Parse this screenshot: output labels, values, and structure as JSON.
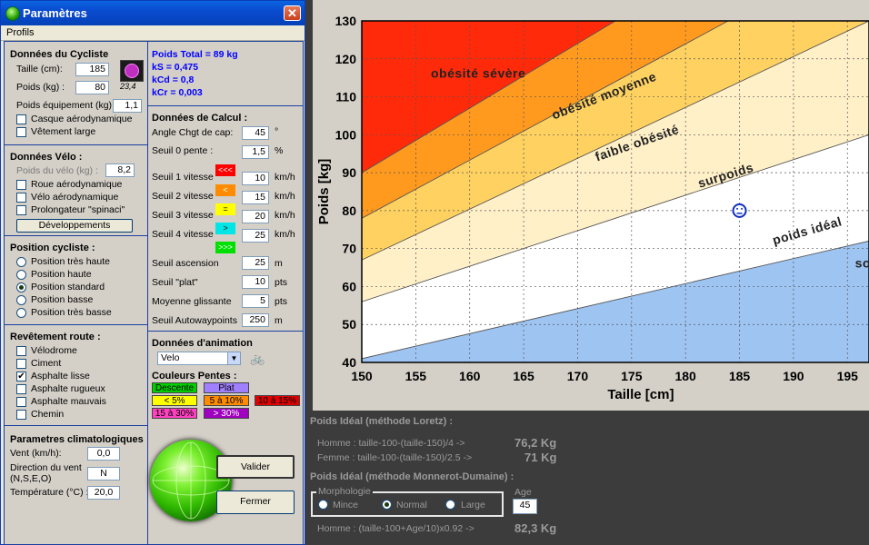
{
  "window": {
    "title": "Paramètres",
    "menu": [
      "Profils"
    ]
  },
  "cycliste": {
    "header": "Données du Cycliste",
    "taille_label": "Taille (cm):",
    "taille": "185",
    "poids_label": "Poids (kg) :",
    "poids": "80",
    "equip_label": "Poids équipement (kg) :",
    "equip": "1,1",
    "casque": "Casque aérodynamique",
    "vetement": "Vêtement large",
    "imc": "23,4"
  },
  "info": {
    "poids_total": "Poids Total = 89 kg",
    "ks": "kS = 0,475",
    "kcd": "kCd = 0,8",
    "kcr": "kCr = 0,003"
  },
  "velo": {
    "header": "Données Vélo :",
    "poids_label": "Poids du vélo (kg) :",
    "poids": "8,2",
    "roue": "Roue aérodynamique",
    "velo_aero": "Vélo aérodynamique",
    "prolong": "Prolongateur \"spinaci\"",
    "dev_button": "Développements"
  },
  "position": {
    "header": "Position cycliste :",
    "items": [
      "Position très haute",
      "Position haute",
      "Position standard",
      "Position basse",
      "Position très basse"
    ]
  },
  "revetement": {
    "header": "Revêtement route :",
    "items": [
      "Vélodrome",
      "Ciment",
      "Asphalte lisse",
      "Asphalte rugueux",
      "Asphalte mauvais",
      "Chemin"
    ]
  },
  "climat": {
    "header": "Parametres climatologiques",
    "vent_label": "Vent (km/h):",
    "vent": "0,0",
    "dir_label1": "Direction du vent",
    "dir_label2": "(N,S,E,O)",
    "dir": "N",
    "temp_label": "Température (°C) :",
    "temp": "20,0"
  },
  "calcul": {
    "header": "Données de Calcul :",
    "angle_label": "Angle Chgt  de cap:",
    "angle": "45",
    "angle_unit": "°",
    "seuil0_label": "Seuil 0 pente :",
    "seuil0": "1,5",
    "seuil0_unit": "%",
    "seuils": [
      {
        "label": "Seuil 1 vitesse",
        "sym": "<<<",
        "value": "10",
        "unit": "km/h",
        "color": "#ff0000"
      },
      {
        "label": "Seuil 2 vitesse",
        "sym": "<",
        "value": "15",
        "unit": "km/h",
        "color": "#ff8c00"
      },
      {
        "label": "Seuil 3 vitesse",
        "sym": "=",
        "value": "20",
        "unit": "km/h",
        "color": "#ffff00"
      },
      {
        "label": "Seuil 4 vitesse",
        "sym": ">",
        "value": "25",
        "unit": "km/h",
        "color": "#00e5e5"
      }
    ],
    "sym5": ">>>",
    "ascension_label": "Seuil  ascension",
    "ascension": "25",
    "ascension_unit": "m",
    "plat_label": "Seuil  \"plat\"",
    "plat": "10",
    "plat_unit": "pts",
    "moyenne_label": "Moyenne glissante",
    "moyenne": "5",
    "moyenne_unit": "pts",
    "autowp_label": "Seuil Autowaypoints",
    "autowp": "250",
    "autowp_unit": "m"
  },
  "animation": {
    "header": "Données d'animation",
    "select": "Velo"
  },
  "couleurs": {
    "header": "Couleurs Pentes :",
    "descente": "Descente",
    "plat": "Plat",
    "c1": "< 5%",
    "c2": "5 à 10%",
    "c3": "10 à 15%",
    "c4": "15 à 30%",
    "c5": "> 30%"
  },
  "buttons": {
    "valider": "Valider",
    "fermer": "Fermer"
  },
  "chart_data": {
    "type": "area",
    "xlabel": "Taille [cm]",
    "ylabel": "Poids [kg]",
    "xlim": [
      150,
      197
    ],
    "ylim": [
      40,
      130
    ],
    "xticks": [
      150,
      155,
      160,
      165,
      170,
      175,
      180,
      185,
      190,
      195
    ],
    "yticks": [
      40,
      50,
      60,
      70,
      80,
      90,
      100,
      110,
      120,
      130
    ],
    "grid": true,
    "bands": [
      {
        "name": "sous",
        "color": "#9ec4f2",
        "lower_at_150": 40,
        "lower_at_197": 40,
        "upper_at_150": 41,
        "upper_at_197": 72
      },
      {
        "name": "poids idéal",
        "color": "#ffffff",
        "lower_at_150": 41,
        "lower_at_197": 72,
        "upper_at_150": 56,
        "upper_at_197": 100
      },
      {
        "name": "surpoids",
        "color": "#fff0c8",
        "lower_at_150": 56,
        "lower_at_197": 100,
        "upper_at_150": 67,
        "upper_at_197": 130
      },
      {
        "name": "faible obésité",
        "color": "#ffd160",
        "lower_at_150": 67,
        "lower_at_197": 130,
        "upper_at_150": 78,
        "upper_at_197": 150
      },
      {
        "name": "obésité moyenne",
        "color": "#ff9a1e",
        "lower_at_150": 78,
        "lower_at_197": 150,
        "upper_at_150": 90,
        "upper_at_197": 170
      },
      {
        "name": "obésité sévère",
        "color": "#ff2a0a",
        "lower_at_150": 90,
        "lower_at_197": 170,
        "upper_at_150": 130,
        "upper_at_197": 200
      }
    ],
    "labels": [
      {
        "text": "obésité sévère",
        "x": 156.4,
        "y": 115,
        "angle": 0
      },
      {
        "text": "obésité moyenne",
        "x": 167.8,
        "y": 104,
        "angle": -21
      },
      {
        "text": "faible obésité",
        "x": 171.8,
        "y": 93,
        "angle": -19
      },
      {
        "text": "surpoids",
        "x": 181.3,
        "y": 86,
        "angle": -17
      },
      {
        "text": "poids idéal",
        "x": 188.2,
        "y": 71,
        "angle": -16
      },
      {
        "text": "sous",
        "x": 195.7,
        "y": 65,
        "angle": 0
      }
    ],
    "marker": {
      "x": 185,
      "y": 80,
      "icon": "smiley-icon"
    }
  },
  "loretz": {
    "header": "Poids Idéal (méthode Loretz) :",
    "homme": "Homme : taille-100-(taille-150)/4  ->",
    "homme_val": "76,2 Kg",
    "femme": "Femme : taille-100-(taille-150)/2.5 ->",
    "femme_val": "71 Kg"
  },
  "monnerot": {
    "header": "Poids Idéal (méthode Monnerot-Dumaine) :",
    "morpho": "Morphologie",
    "mince": "Mince",
    "normal": "Normal",
    "large": "Large",
    "age_label": "Age",
    "age": "45",
    "homme": "Homme : (taille-100+Age/10)x0.92 ->",
    "homme_val": "82,3 Kg"
  }
}
